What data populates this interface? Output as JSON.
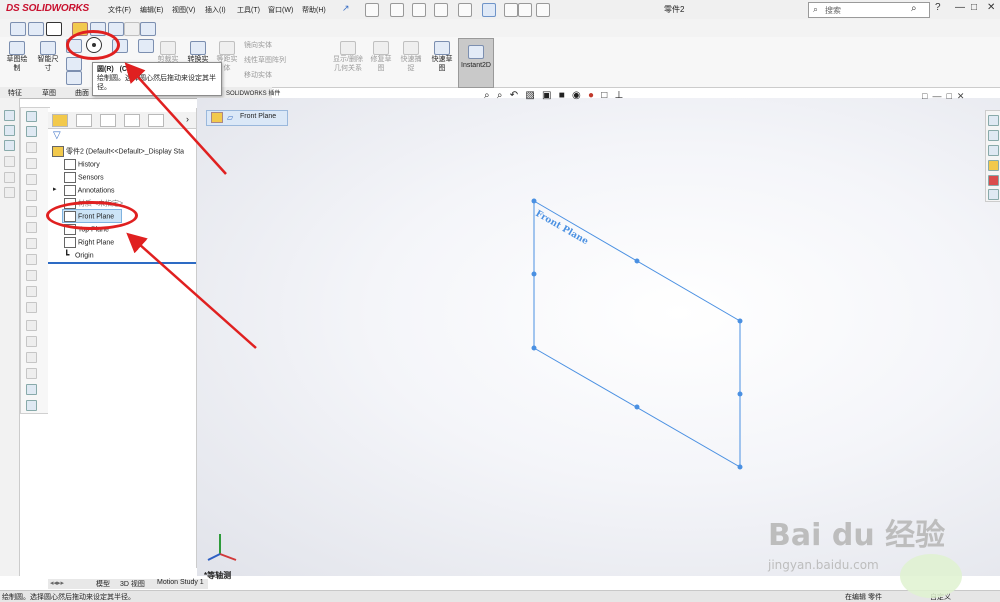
{
  "app": {
    "logo": "SOLIDWORKS",
    "logo_mark": "DS",
    "title": "零件2"
  },
  "menu": [
    "文件(F)",
    "编辑(E)",
    "视图(V)",
    "插入(I)",
    "工具(T)",
    "窗口(W)",
    "帮助(H)"
  ],
  "search": {
    "placeholder": "搜索"
  },
  "window_controls": {
    "help": "?",
    "minimize": "—",
    "restore": "□",
    "close": "✕"
  },
  "ribbon": {
    "sketch": "草图绘\n制",
    "smart_dim": "智能尺\n寸",
    "trim": "剪裁实\n体",
    "convert": "转换实\n体引用",
    "offset": "等距实\n体",
    "mirror": "镜向实体",
    "linear_pattern": "线性草图阵列",
    "move": "移动实体",
    "relations": "显示/删除\n几何关系",
    "repair": "修复草\n图",
    "quick_snap": "快速捕\n捉",
    "rapid_sketch": "快速草\n图",
    "instant2d": "Instant2D"
  },
  "tooltip": {
    "title": "圆(R)",
    "shortcut": "(C)",
    "body": "绘制圆。选择圆心然后拖动来设定其半径。"
  },
  "cmd_tabs": [
    "特征",
    "草图",
    "曲面",
    "钣金",
    "焊件",
    "评估",
    "SOLIDWORKS 插件"
  ],
  "tree": {
    "root": "零件2  (Default<<Default>_Display Sta",
    "items": [
      "History",
      "Sensors",
      "Annotations",
      "材质 <未指定>",
      "Front Plane",
      "Top Plane",
      "Right Plane",
      "Origin"
    ]
  },
  "breadcrumb": "Front Plane",
  "plane_label": "Front Plane",
  "view_label": "*等轴测",
  "bottom_tabs": [
    "模型",
    "3D 视图",
    "Motion Study 1"
  ],
  "status": {
    "left": "绘制圆。选择圆心然后拖动来设定其半径。",
    "mode": "在编辑 零件",
    "right": "自定义"
  },
  "watermark": {
    "brand": "Bai du 经验",
    "url": "jingyan.baidu.com"
  },
  "colors": {
    "accent": "#3a8de6",
    "annotation_red": "#e02020",
    "plane_edge": "#4a90e2"
  }
}
